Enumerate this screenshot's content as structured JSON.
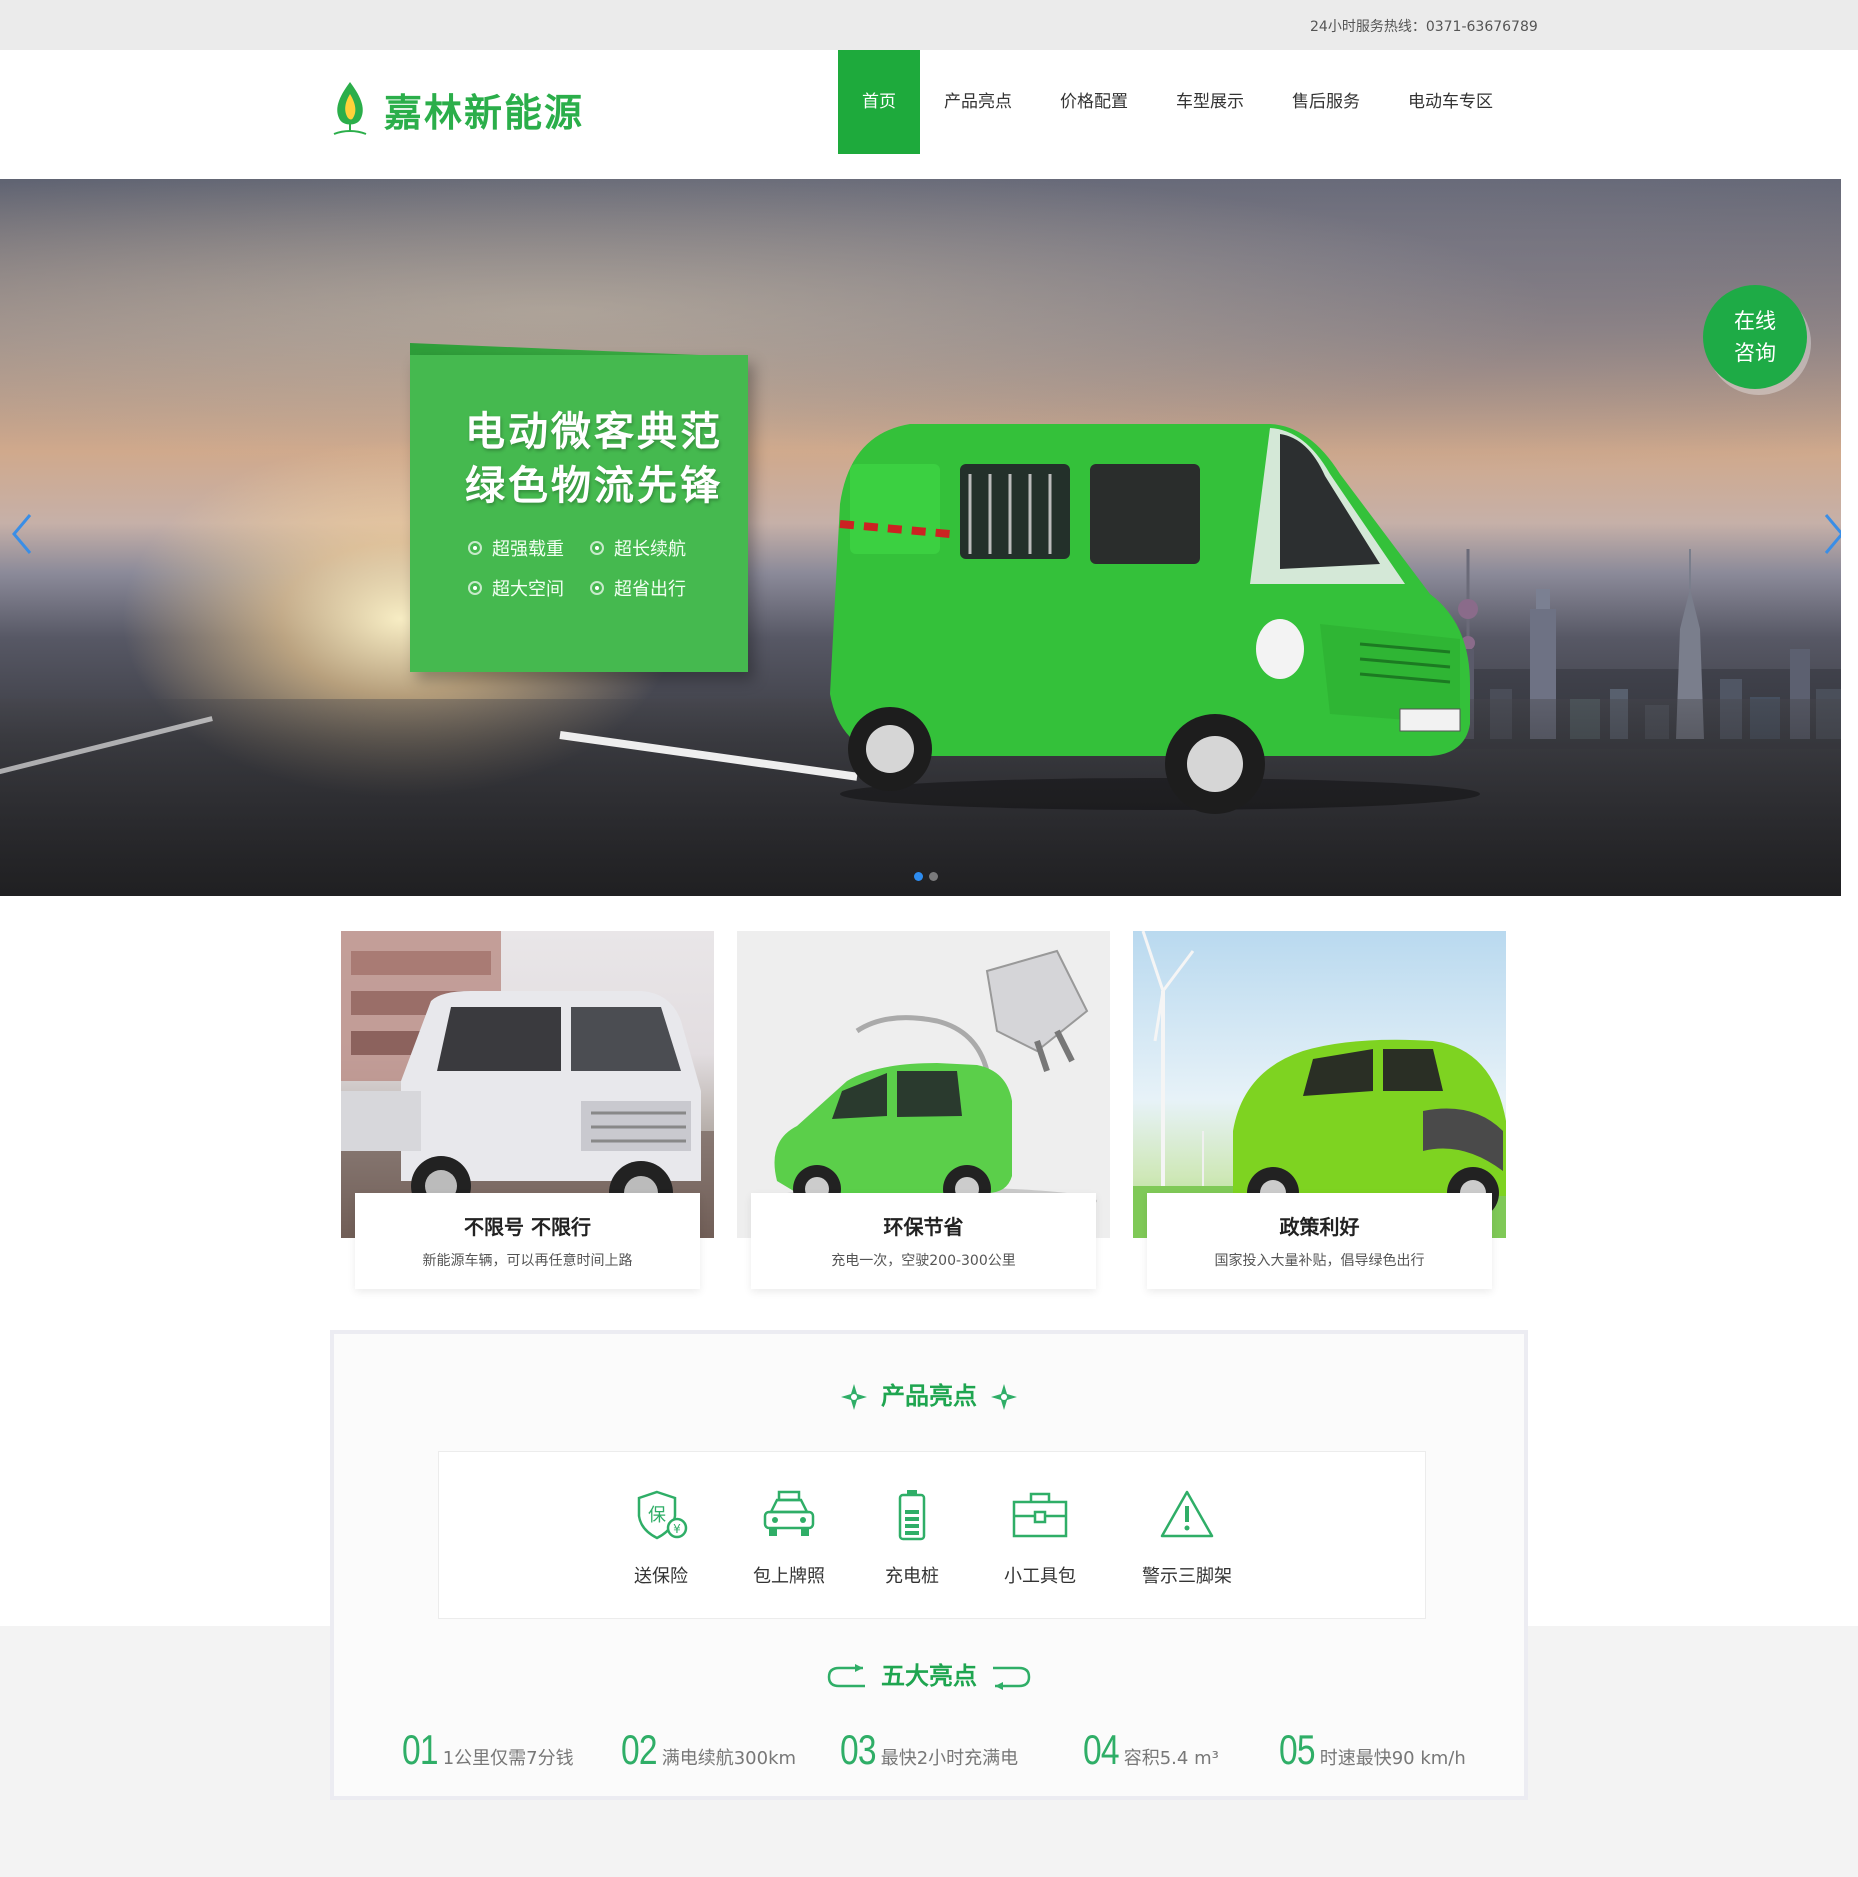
{
  "topbar": {
    "hotline_label": "24小时服务热线：",
    "hotline_number": "0371-63676789"
  },
  "brand": {
    "name": "嘉林新能源",
    "color": "#2bae4a"
  },
  "nav": {
    "items": [
      {
        "label": "首页",
        "active": true
      },
      {
        "label": "产品亮点",
        "active": false
      },
      {
        "label": "价格配置",
        "active": false
      },
      {
        "label": "车型展示",
        "active": false
      },
      {
        "label": "售后服务",
        "active": false
      },
      {
        "label": "电动车专区",
        "active": false
      }
    ],
    "active_color": "#1eaa3c"
  },
  "banner": {
    "headline_line1": "电动微客典范",
    "headline_line2": "绿色物流先锋",
    "features": [
      "超强载重",
      "超长续航",
      "超大空间",
      "超省出行"
    ],
    "consult_line1": "在线",
    "consult_line2": "咨询",
    "prev_icon": "chevron-left-icon",
    "next_icon": "chevron-right-icon",
    "slide_count": 2,
    "active_slide": 1
  },
  "cards": [
    {
      "title": "不限号 不限行",
      "desc": "新能源车辆，可以再任意时间上路"
    },
    {
      "title": "环保节省",
      "desc": "充电一次，空驶200-300公里"
    },
    {
      "title": "政策利好",
      "desc": "国家投入大量补贴，倡导绿色出行"
    }
  ],
  "highlights": {
    "title": "产品亮点",
    "perks": [
      {
        "label": "送保险",
        "icon": "insurance-shield-icon",
        "glyph": "保"
      },
      {
        "label": "包上牌照",
        "icon": "car-license-icon"
      },
      {
        "label": "充电桩",
        "icon": "battery-icon"
      },
      {
        "label": "小工具包",
        "icon": "toolbox-icon"
      },
      {
        "label": "警示三脚架",
        "icon": "warning-triangle-icon"
      }
    ],
    "five_title": "五大亮点",
    "five": [
      {
        "num": "01",
        "text": "1公里仅需7分钱"
      },
      {
        "num": "02",
        "text": "满电续航300km"
      },
      {
        "num": "03",
        "text": "最快2小时充满电"
      },
      {
        "num": "04",
        "text": "容积5.4 m³"
      },
      {
        "num": "05",
        "text": "时速最快90 km/h"
      }
    ]
  }
}
